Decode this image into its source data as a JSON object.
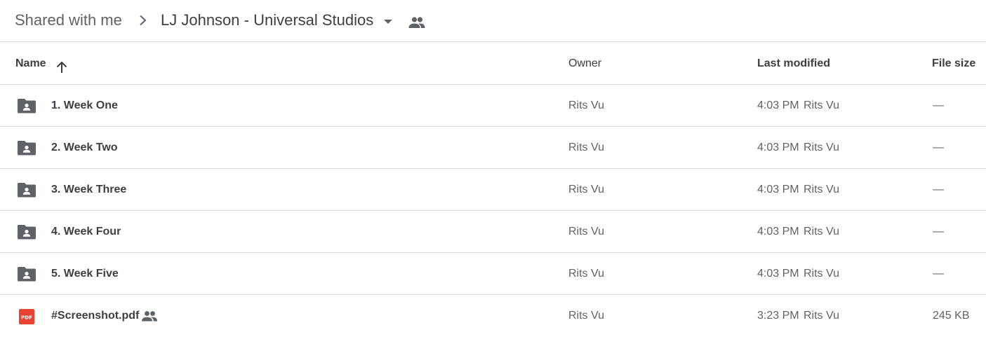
{
  "breadcrumb": {
    "root": "Shared with me",
    "current": "LJ Johnson - Universal Studios"
  },
  "columns": {
    "name": "Name",
    "owner": "Owner",
    "last_modified": "Last modified",
    "file_size": "File size"
  },
  "sort": {
    "column": "name",
    "direction": "ascending"
  },
  "files": [
    {
      "type": "shared-folder",
      "name": "1. Week One",
      "owner": "Rits Vu",
      "modified_time": "4:03 PM",
      "modified_by": "Rits Vu",
      "size": "—"
    },
    {
      "type": "shared-folder",
      "name": "2. Week Two",
      "owner": "Rits Vu",
      "modified_time": "4:03 PM",
      "modified_by": "Rits Vu",
      "size": "—"
    },
    {
      "type": "shared-folder",
      "name": "3. Week Three",
      "owner": "Rits Vu",
      "modified_time": "4:03 PM",
      "modified_by": "Rits Vu",
      "size": "—"
    },
    {
      "type": "shared-folder",
      "name": "4. Week Four",
      "owner": "Rits Vu",
      "modified_time": "4:03 PM",
      "modified_by": "Rits Vu",
      "size": "—"
    },
    {
      "type": "shared-folder",
      "name": "5. Week Five",
      "owner": "Rits Vu",
      "modified_time": "4:03 PM",
      "modified_by": "Rits Vu",
      "size": "—"
    },
    {
      "type": "pdf",
      "name": "#Screenshot.pdf",
      "shared": true,
      "owner": "Rits Vu",
      "modified_time": "3:23 PM",
      "modified_by": "Rits Vu",
      "size": "245 KB",
      "icon_label": "PDF"
    }
  ],
  "colors": {
    "folder_icon": "#5f6368",
    "pdf_icon": "#ea4335",
    "divider": "#dadce0",
    "text_primary": "#3c4043",
    "text_secondary": "#5f6368"
  },
  "icons": {
    "breadcrumb_separator": "chevron-right-icon",
    "dropdown": "arrow-drop-down-icon",
    "people": "people-icon",
    "sort": "arrow-upward-icon",
    "folder": "shared-folder-icon",
    "pdf": "pdf-icon"
  }
}
